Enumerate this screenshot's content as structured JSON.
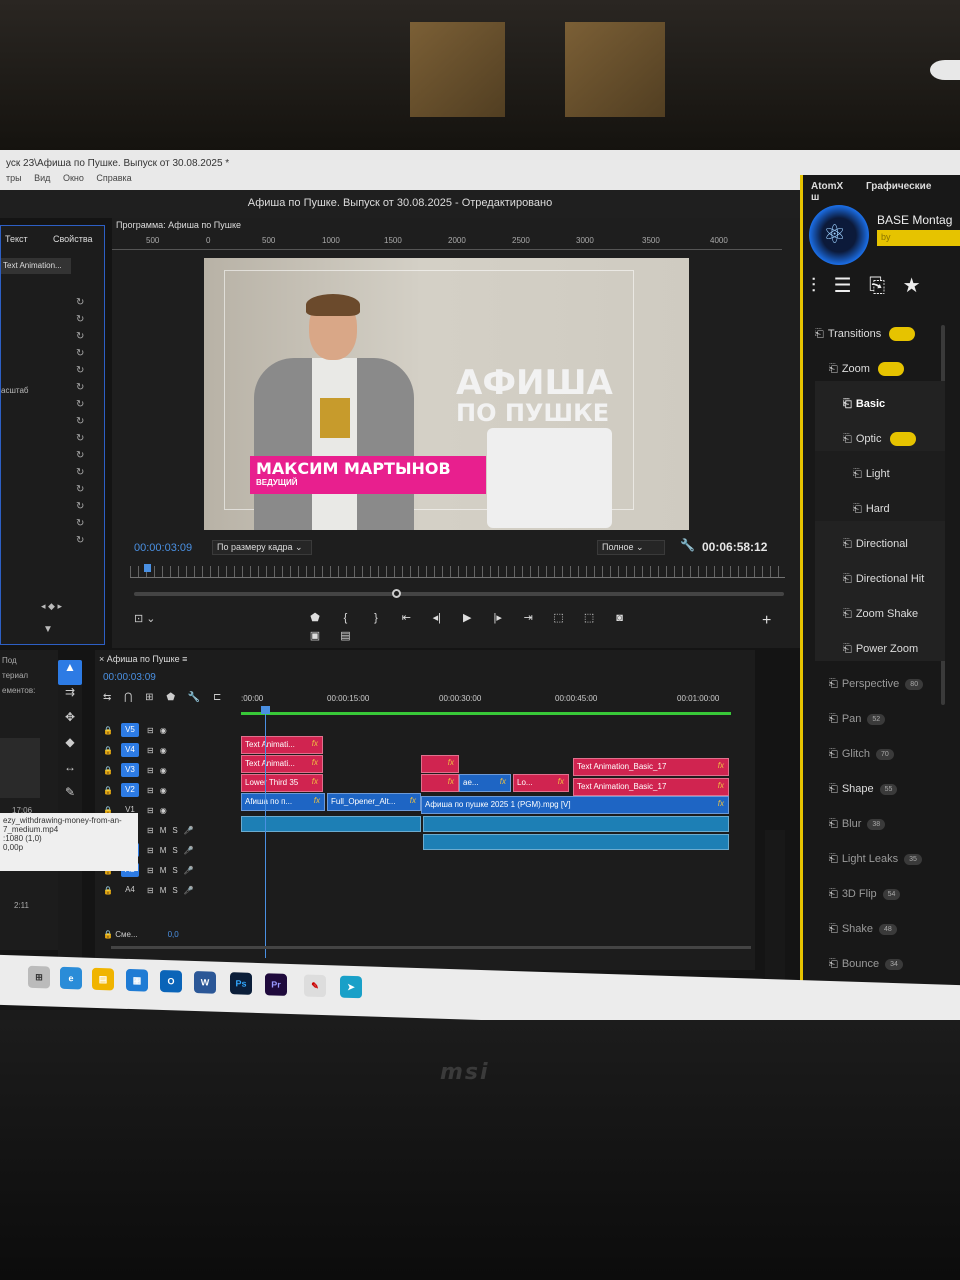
{
  "window": {
    "title": "уск 23\\Афиша по Пушке. Выпуск от 30.08.2025 *",
    "menus": [
      "тры",
      "Вид",
      "Окно",
      "Справка"
    ],
    "header": "Афиша по Пушке. Выпуск от 30.08.2025 - Отредактировано"
  },
  "effects_panel": {
    "tab_text": "Текст",
    "tab_properties": "Свойства",
    "item": "Text Animation...",
    "scale_label": "асштаб"
  },
  "program_monitor": {
    "title": "Программа: Афиша по Пушке",
    "ruler_marks": [
      "500",
      "0",
      "500",
      "1000",
      "1500",
      "2000",
      "2500",
      "3000",
      "3500",
      "4000"
    ],
    "timecode_current": "00:00:03:09",
    "timecode_duration": "00:06:58:12",
    "fit_option": "По размеру кадра",
    "quality_option": "Полное",
    "video": {
      "title_line1": "АФИША",
      "title_line2": "ПО ПУШКЕ",
      "lower_third_name": "МАКСИМ МАРТЫНОВ",
      "lower_third_role": "ВЕДУЩИЙ"
    }
  },
  "atomx": {
    "tab_main": "AtomX",
    "tab_graphics": "Графические ш",
    "pack_name": "BASE Montag",
    "pack_by": "by",
    "presets": [
      {
        "label": "Transitions",
        "level": 0,
        "pill": true
      },
      {
        "label": "Zoom",
        "level": 1,
        "pill": true
      },
      {
        "label": "Basic",
        "level": 2,
        "active": true
      },
      {
        "label": "Optic",
        "level": 2,
        "pill": true
      },
      {
        "label": "Light",
        "level": 3
      },
      {
        "label": "Hard",
        "level": 3
      },
      {
        "label": "Directional",
        "level": 2
      },
      {
        "label": "Directional Hit",
        "level": 2
      },
      {
        "label": "Zoom Shake",
        "level": 2
      },
      {
        "label": "Power Zoom",
        "level": 2
      },
      {
        "label": "Perspective",
        "level": 1,
        "count": "80",
        "dim": true
      },
      {
        "label": "Pan",
        "level": 1,
        "count": "52",
        "dim": true
      },
      {
        "label": "Glitch",
        "level": 1,
        "count": "70",
        "dim": true
      },
      {
        "label": "Shape",
        "level": 1,
        "count": "55"
      },
      {
        "label": "Blur",
        "level": 1,
        "count": "38",
        "dim": true
      },
      {
        "label": "Light Leaks",
        "level": 1,
        "count": "35",
        "dim": true
      },
      {
        "label": "3D Flip",
        "level": 1,
        "count": "54",
        "dim": true
      },
      {
        "label": "Shake",
        "level": 1,
        "count": "48",
        "dim": true
      },
      {
        "label": "Bounce",
        "level": 1,
        "count": "34",
        "dim": true
      }
    ]
  },
  "project_panel": {
    "tab": "Под",
    "label1": "териал",
    "label2": "ементов:",
    "time1": "17:06",
    "time2": "2:11",
    "tooltip_line1": "ezy_withdrawing-money-from-an-",
    "tooltip_line2": "7_medium.mp4",
    "tooltip_line3": ":1080 (1,0)",
    "tooltip_line4": "0,00p"
  },
  "timeline": {
    "sequence_tab": "Афиша по Пушке",
    "timecode": "00:00:03:09",
    "ruler": [
      ":00:00",
      "00:00:15:00",
      "00:00:30:00",
      "00:00:45:00",
      "00:01:00:00"
    ],
    "tracks": [
      "V5",
      "V4",
      "V3",
      "V2",
      "V1",
      "A1",
      "A2",
      "A3",
      "A4"
    ],
    "mix_label": "Сме...",
    "mix_value": "0,0",
    "clips": {
      "c1": "Text Animati...",
      "c2": "Text Animati...",
      "c3": "Lower Third 35",
      "c4": "Afиша по п...",
      "c5": "Full_Opener_Alt...",
      "c6": "Text Animation_Basic_17",
      "c7": "Text Animation_Basic_17",
      "c8": "ae...",
      "c9": "Lo...",
      "c10": "Афиша по пушке 2025 1 (PGM).mpg [V]",
      "fx": "fx"
    }
  },
  "meter": {
    "label": "S S"
  },
  "brand": "msi",
  "colors": {
    "accent": "#2d7be4",
    "atomx_yellow": "#e6c300",
    "clip_pink": "#d02450",
    "lower_third": "#e81f8e"
  }
}
